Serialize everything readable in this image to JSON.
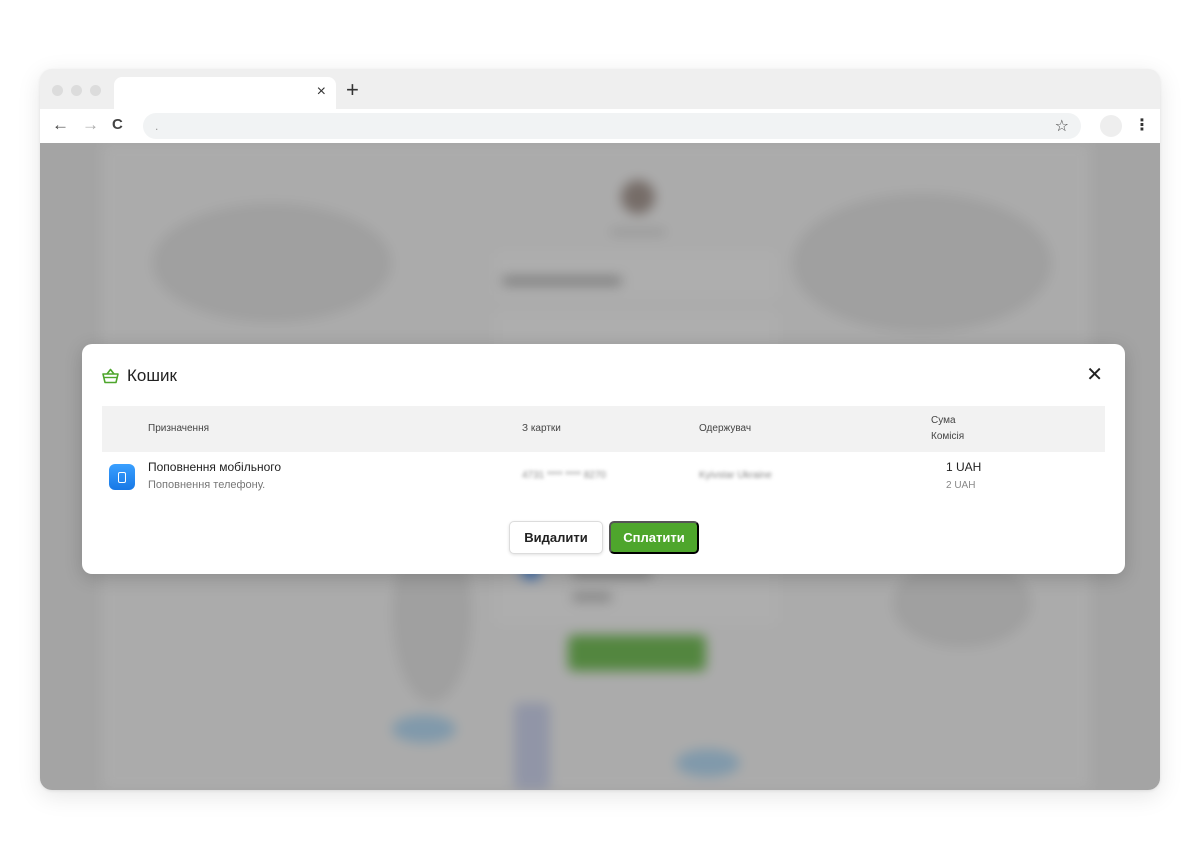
{
  "browser": {
    "tab_close": "×",
    "new_tab": "+",
    "back": "←",
    "forward": "→",
    "reload": "C",
    "address": ".",
    "star": "☆",
    "menu": "⋮"
  },
  "modal": {
    "title": "Кошик",
    "close": "✕",
    "accent_color": "#4ea62c",
    "columns": {
      "purpose": "Призначення",
      "from_card": "З картки",
      "recipient": "Одержувач",
      "sum": "Сума",
      "fee": "Комісія"
    },
    "rows": [
      {
        "icon": "phone-icon",
        "title": "Поповнення мобільного",
        "subtitle": "Поповнення телефону.",
        "card": "4731 **** **** 8270",
        "recipient": "Kyivstar Ukraine",
        "amount": "1 UAH",
        "fee": "2 UAH"
      }
    ],
    "buttons": {
      "delete": "Видалити",
      "pay": "Сплатити"
    }
  }
}
